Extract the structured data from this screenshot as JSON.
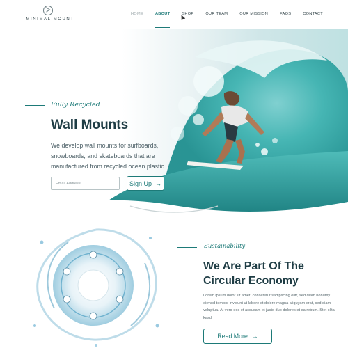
{
  "brand": {
    "name": "MINIMAL MOUNT",
    "logo_icon": "mountain-circle-icon"
  },
  "nav": {
    "items": [
      {
        "label": "HOME",
        "state": "muted"
      },
      {
        "label": "ABOUT",
        "state": "active"
      },
      {
        "label": "SHOP",
        "state": "normal"
      },
      {
        "label": "OUR TEAM",
        "state": "normal"
      },
      {
        "label": "OUR MISSION",
        "state": "normal"
      },
      {
        "label": "FAQS",
        "state": "normal"
      },
      {
        "label": "CONTACT",
        "state": "normal"
      }
    ]
  },
  "hero": {
    "kicker": "Fully Recycled",
    "title": "Wall Mounts",
    "body": "We develop wall mounts for surfboards, snowboards, and skateboards that are manufactured from recycled ocean plastic.",
    "email_placeholder": "Email Address",
    "signup_label": "Sign Up",
    "signup_icon": "arrow-right-icon"
  },
  "economy": {
    "kicker": "Sustainability",
    "title": "We Are Part Of The Circular Economy",
    "body": "Lorem ipsum dolor sit amet, consetetur sadipscing elitr, sed diam nonumy eirmod tempor invidunt ut labore et dolore magna aliquyam erat, sed diam voluptua. At vero eos et accusam et justo duo dolores et ea rebum. Stet clita kasd",
    "more_label": "Read More",
    "more_icon": "arrow-right-icon"
  },
  "colors": {
    "accent": "#1d7a78",
    "text": "#1f3d45",
    "water": "#2fa7a4"
  }
}
